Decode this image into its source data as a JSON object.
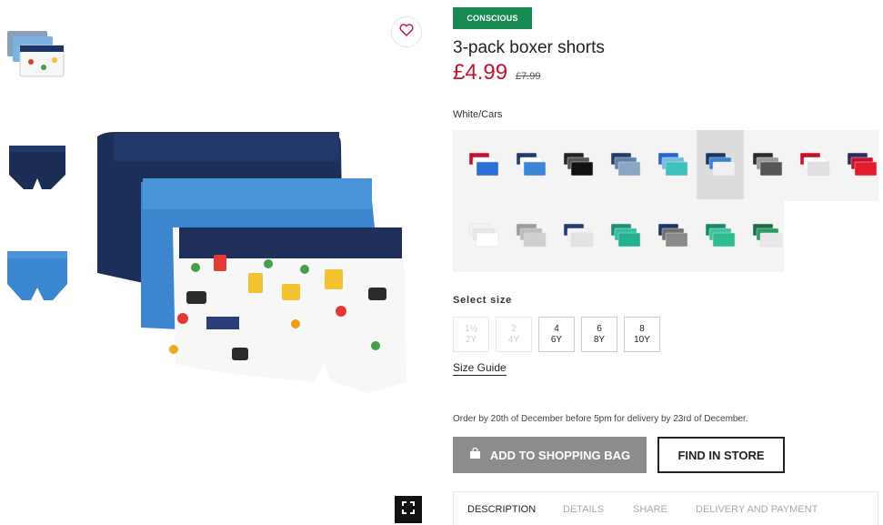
{
  "product": {
    "badge": "CONSCIOUS",
    "title": "3-pack boxer shorts",
    "price": "£4.99",
    "old_price": "£7.99",
    "color_name": "White/Cars"
  },
  "swatches": [
    {
      "name": "red-white-blue",
      "colors": [
        "#c8102e",
        "#ffffff",
        "#2a6fd6"
      ]
    },
    {
      "name": "navy-blue",
      "colors": [
        "#1e3a6e",
        "#ffffff",
        "#3a85d8"
      ]
    },
    {
      "name": "black",
      "colors": [
        "#222222",
        "#555555",
        "#111111"
      ]
    },
    {
      "name": "navy-grey",
      "colors": [
        "#243b66",
        "#5f7fa8",
        "#8aa6c4"
      ]
    },
    {
      "name": "blue-turquoise",
      "colors": [
        "#2b64c8",
        "#6fbfe0",
        "#3ec2c0"
      ]
    },
    {
      "name": "navy-blue-cars",
      "colors": [
        "#1c3566",
        "#3a7fd0",
        "#f0f0f0"
      ]
    },
    {
      "name": "black-grey",
      "colors": [
        "#2a2a2a",
        "#9a9a9a",
        "#555555"
      ]
    },
    {
      "name": "red-white-cars",
      "colors": [
        "#c8102e",
        "#ffffff",
        "#e0e0e0"
      ]
    },
    {
      "name": "navy-red",
      "colors": [
        "#2a2d5e",
        "#c8102e",
        "#e31b2e"
      ]
    },
    {
      "name": "white",
      "colors": [
        "#f2f2f2",
        "#e6e6e6",
        "#ffffff"
      ]
    },
    {
      "name": "grey",
      "colors": [
        "#9c9c9c",
        "#bdbdbd",
        "#cfcfcf"
      ]
    },
    {
      "name": "navy-white-pattern",
      "colors": [
        "#1f3c74",
        "#f2f2f2",
        "#e3e3e3"
      ]
    },
    {
      "name": "green-turquoise",
      "colors": [
        "#1d8f73",
        "#2cbfa0",
        "#23b28f"
      ]
    },
    {
      "name": "navy-grey-dark",
      "colors": [
        "#1f3466",
        "#707070",
        "#8a8a8a"
      ]
    },
    {
      "name": "green-mint",
      "colors": [
        "#178a63",
        "#3ac5a0",
        "#2dbb8f"
      ]
    },
    {
      "name": "green-white",
      "colors": [
        "#1d6b4a",
        "#2c9a63",
        "#e8e8e8"
      ]
    }
  ],
  "selected_swatch_index": 5,
  "sizes": {
    "label": "Select size",
    "options": [
      {
        "top": "1½",
        "bottom": "2Y",
        "available": false
      },
      {
        "top": "2",
        "bottom": "4Y",
        "available": false
      },
      {
        "top": "4",
        "bottom": "6Y",
        "available": true
      },
      {
        "top": "6",
        "bottom": "8Y",
        "available": true
      },
      {
        "top": "8",
        "bottom": "10Y",
        "available": true
      }
    ],
    "guide_label": "Size Guide"
  },
  "delivery_text": "Order by 20th of December before 5pm for delivery by 23rd of December.",
  "actions": {
    "add_to_bag": "ADD TO SHOPPING BAG",
    "find_in_store": "FIND IN STORE"
  },
  "tabs": [
    {
      "label": "DESCRIPTION",
      "active": true
    },
    {
      "label": "DETAILS",
      "active": false
    },
    {
      "label": "SHARE",
      "active": false
    },
    {
      "label": "DELIVERY AND PAYMENT",
      "active": false
    }
  ],
  "icons": {
    "favorite": "heart-icon",
    "zoom": "fullscreen-icon",
    "bag": "shopping-bag-icon"
  },
  "colors": {
    "accent_price": "#c8102e",
    "badge": "#1a8a55",
    "primary_button": "#8c8c8c"
  }
}
